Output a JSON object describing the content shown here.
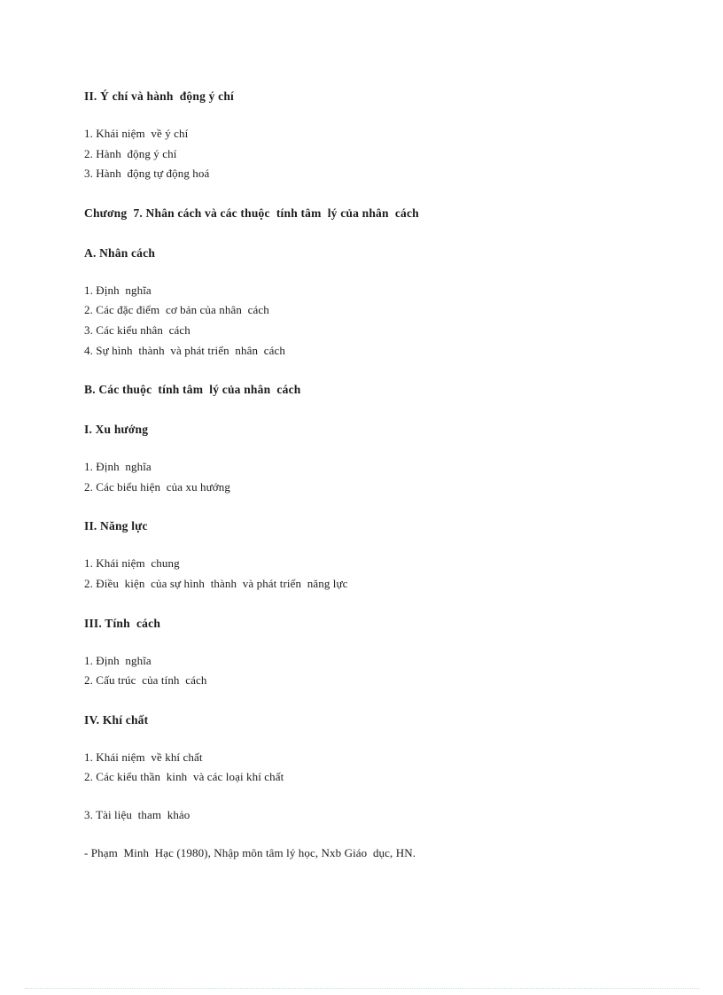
{
  "document": {
    "blocks": [
      {
        "type": "heading",
        "text": "II. Ý chí và hành  động ý chí"
      },
      {
        "type": "item",
        "text": "1. Khái niệm  về ý chí"
      },
      {
        "type": "item",
        "text": "2. Hành  động ý chí"
      },
      {
        "type": "item",
        "text": "3. Hành  động tự động hoá"
      },
      {
        "type": "heading",
        "text": "Chương  7. Nhân cách và các thuộc  tính tâm  lý của nhân  cách"
      },
      {
        "type": "heading",
        "text": "A. Nhân cách"
      },
      {
        "type": "item",
        "text": "1. Định  nghĩa"
      },
      {
        "type": "item",
        "text": "2. Các đặc điểm  cơ bản của nhân  cách"
      },
      {
        "type": "item",
        "text": "3. Các kiểu nhân  cách"
      },
      {
        "type": "item",
        "text": "4. Sự hình  thành  và phát triển  nhân  cách"
      },
      {
        "type": "heading",
        "text": "B. Các thuộc  tính tâm  lý của nhân  cách"
      },
      {
        "type": "heading",
        "text": "I. Xu hướng"
      },
      {
        "type": "item",
        "text": "1. Định  nghĩa"
      },
      {
        "type": "item",
        "text": "2. Các biểu hiện  của xu hướng"
      },
      {
        "type": "heading",
        "text": "II. Năng lực"
      },
      {
        "type": "item",
        "text": "1. Khái niệm  chung"
      },
      {
        "type": "item",
        "text": "2. Điều  kiện  của sự hình  thành  và phát triển  năng lực"
      },
      {
        "type": "heading",
        "text": "III. Tính  cách"
      },
      {
        "type": "item",
        "text": "1. Định  nghĩa"
      },
      {
        "type": "item",
        "text": "2. Cấu trúc  của tính  cách"
      },
      {
        "type": "heading",
        "text": "IV. Khí chất"
      },
      {
        "type": "item",
        "text": "1. Khái niệm  về khí chất"
      },
      {
        "type": "item",
        "text": "2. Các kiểu thần  kinh  và các loại khí chất"
      },
      {
        "type": "item",
        "text": "3. Tài liệu  tham  khảo"
      },
      {
        "type": "reference",
        "text": "- Phạm  Minh  Hạc (1980), Nhập môn tâm lý học, Nxb Giáo  dục, HN."
      }
    ],
    "sections": {
      "section_2_heading": "II. Ý chí và hành  động ý chí",
      "section_2_items": [
        "1. Khái niệm  về ý chí",
        "2. Hành  động ý chí",
        "3. Hành  động tự động hoá"
      ],
      "chapter_7_heading": "Chương  7. Nhân cách và các thuộc  tính tâm  lý của nhân  cách",
      "part_a_heading": "A. Nhân cách",
      "part_a_items": [
        "1. Định  nghĩa",
        "2. Các đặc điểm  cơ bản của nhân  cách",
        "3. Các kiểu nhân  cách",
        "4. Sự hình  thành  và phát triển  nhân  cách"
      ],
      "part_b_heading": "B. Các thuộc  tính tâm  lý của nhân  cách",
      "sub_i_heading": "I. Xu hướng",
      "sub_i_items": [
        "1. Định  nghĩa",
        "2. Các biểu hiện  của xu hướng"
      ],
      "sub_ii_heading": "II. Năng lực",
      "sub_ii_items": [
        "1. Khái niệm  chung",
        "2. Điều  kiện  của sự hình  thành  và phát triển  năng lực"
      ],
      "sub_iii_heading": "III. Tính  cách",
      "sub_iii_items": [
        "1. Định  nghĩa",
        "2. Cấu trúc  của tính  cách"
      ],
      "sub_iv_heading": "IV. Khí chất",
      "sub_iv_items": [
        "1. Khái niệm  về khí chất",
        "2. Các kiểu thần  kinh  và các loại khí chất"
      ],
      "references_heading": "3. Tài liệu  tham  khảo",
      "reference_entry": "- Phạm  Minh  Hạc (1980), Nhập môn tâm lý học, Nxb Giáo  dục, HN."
    }
  },
  "colors": {
    "page_background": "#ffffff",
    "text": "#1c1c1c",
    "bottom_rule": "#b9d8ea"
  }
}
